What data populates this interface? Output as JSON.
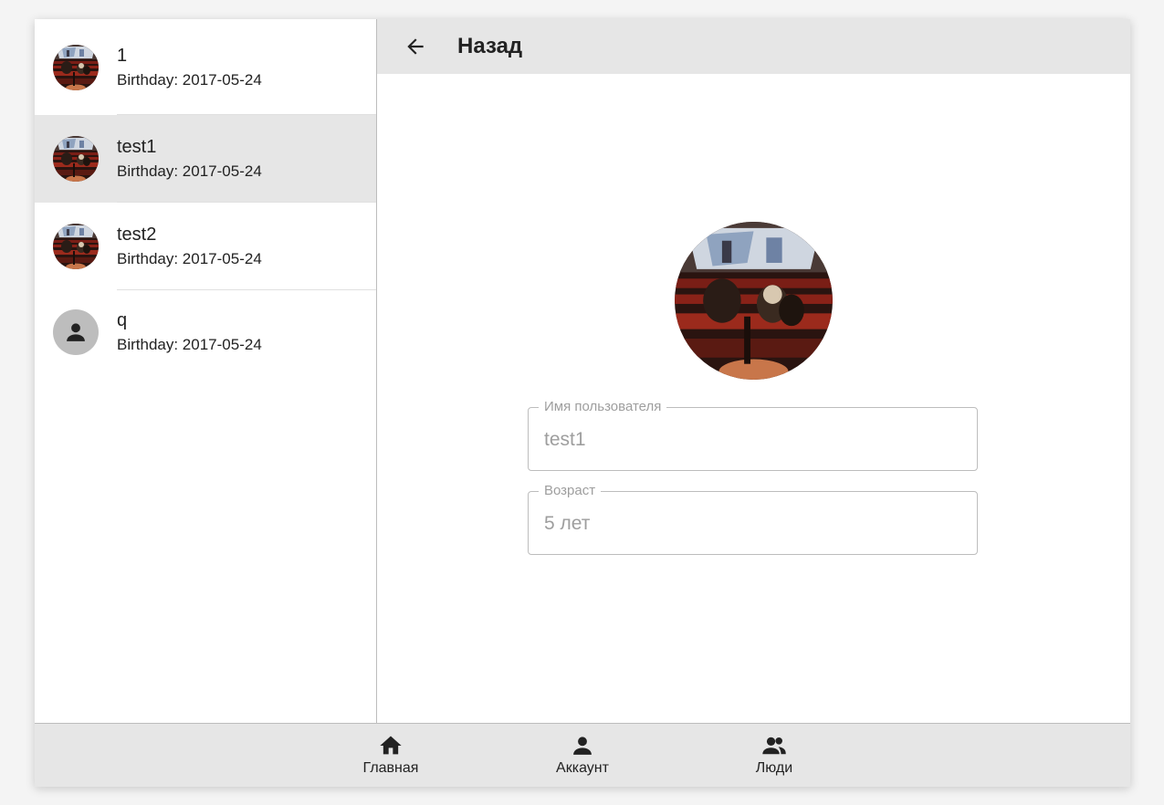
{
  "people": [
    {
      "name": "1",
      "subtitle": "Birthday: 2017-05-24",
      "avatar": "photo",
      "selected": false
    },
    {
      "name": "test1",
      "subtitle": "Birthday: 2017-05-24",
      "avatar": "photo",
      "selected": true
    },
    {
      "name": "test2",
      "subtitle": "Birthday: 2017-05-24",
      "avatar": "photo",
      "selected": false
    },
    {
      "name": "q",
      "subtitle": "Birthday: 2017-05-24",
      "avatar": "person-icon",
      "selected": false
    }
  ],
  "detail": {
    "back_icon": "arrow-left-icon",
    "title": "Назад",
    "username_label": "Имя пользователя",
    "username_value": "test1",
    "age_label": "Возраст",
    "age_value": "5 лет"
  },
  "nav": {
    "home_label": "Главная",
    "home_icon": "home-icon",
    "account_label": "Аккаунт",
    "account_icon": "person-icon",
    "people_label": "Люди",
    "people_icon": "people-icon"
  },
  "colors": {
    "toolbar_bg": "#e6e6e6",
    "selected_bg": "#e6e6e6",
    "border": "#bdbdbd",
    "placeholder_text": "#9e9e9e"
  }
}
